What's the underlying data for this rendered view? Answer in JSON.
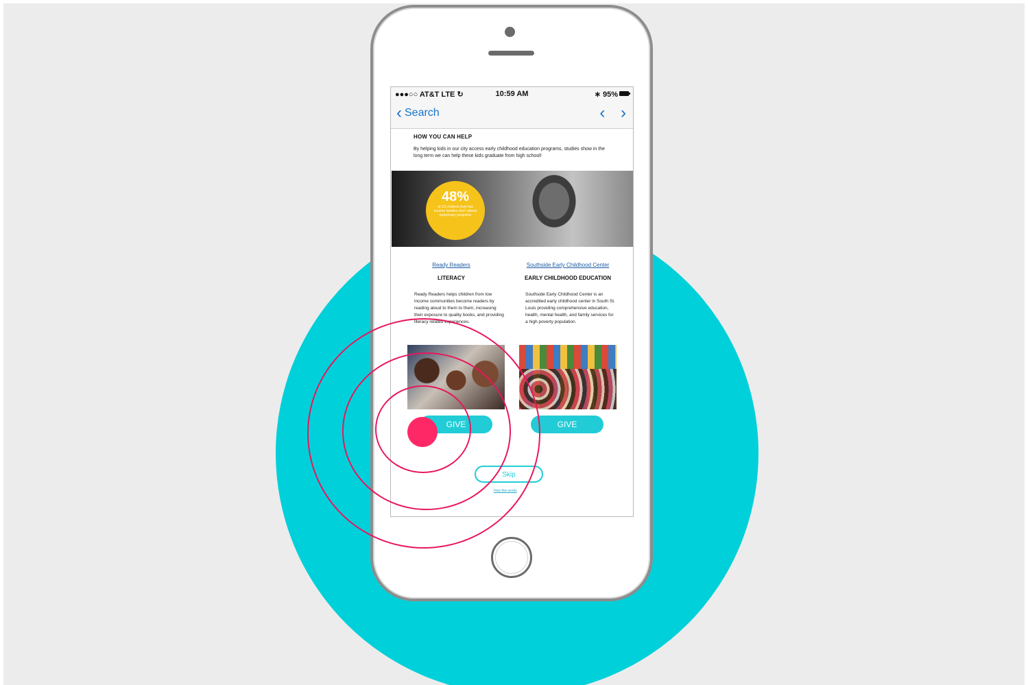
{
  "status_bar": {
    "carrier": "●●●○○ AT&T  LTE ↻",
    "time": "10:59 AM",
    "battery": "∗ 95%"
  },
  "nav": {
    "back_label": "Search",
    "back_icon": "‹",
    "prev_icon": "‹",
    "next_icon": "›"
  },
  "help": {
    "title": "HOW YOU CAN HELP",
    "text": "By helping kids in our city access early childhood education programs, studies show in the long term we can help these kids graduate from high school!"
  },
  "hero": {
    "stat_value": "48%",
    "stat_text": "of US children from low income families don't attend preprimary programs"
  },
  "charities": [
    {
      "name": "Ready Readers",
      "category": "LITERACY",
      "description": "Ready Readers helps children from low income communities become readers by reading aloud to them to them, increasing their exposure to quality books, and providing literacy related experiences.",
      "give_label": "GIVE"
    },
    {
      "name": "Southside Early Childhood Center",
      "category": "EARLY CHILDHOOD EDUCATION",
      "description": "Southside Early Childhood Center is an accredited early childhood center in South St. Louis providing comprehensive education, health, mental health, and family services for a high poverty population.",
      "give_label": "GIVE"
    }
  ],
  "footer": {
    "skip_label": "Skip",
    "how_link": "How this works"
  },
  "colors": {
    "teal": "#00d0da",
    "pink": "#e8175d",
    "yellow": "#f6c31a",
    "ios_blue": "#1672cc"
  }
}
